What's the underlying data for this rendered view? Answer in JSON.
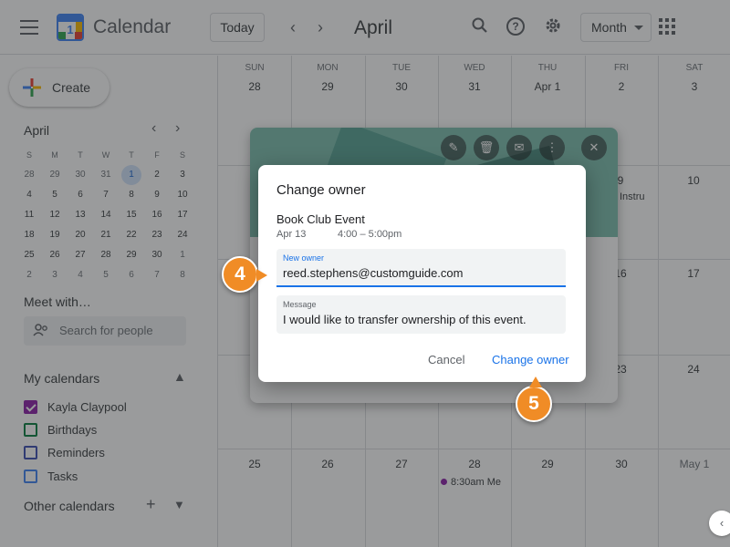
{
  "header": {
    "app_title": "Calendar",
    "logo_day": "1",
    "today_label": "Today",
    "prev_glyph": "‹",
    "next_glyph": "›",
    "month": "April",
    "view_select": "Month",
    "icons": [
      "menu-icon",
      "search-icon",
      "help-icon",
      "gear-icon",
      "apps-icon"
    ]
  },
  "sidebar": {
    "create_label": "Create",
    "mini_calendar": {
      "month": "April",
      "days_of_week": [
        "S",
        "M",
        "T",
        "W",
        "T",
        "F",
        "S"
      ],
      "weeks": [
        [
          "28",
          "29",
          "30",
          "31",
          "1",
          "2",
          "3"
        ],
        [
          "4",
          "5",
          "6",
          "7",
          "8",
          "9",
          "10"
        ],
        [
          "11",
          "12",
          "13",
          "14",
          "15",
          "16",
          "17"
        ],
        [
          "18",
          "19",
          "20",
          "21",
          "22",
          "23",
          "24"
        ],
        [
          "25",
          "26",
          "27",
          "28",
          "29",
          "30",
          "1"
        ],
        [
          "2",
          "3",
          "4",
          "5",
          "6",
          "7",
          "8"
        ]
      ]
    },
    "meet_title": "Meet with…",
    "people_search_placeholder": "Search for people",
    "my_calendars_title": "My calendars",
    "my_calendars": [
      {
        "label": "Kayla Claypool",
        "color": "#8e24aa",
        "checked": true
      },
      {
        "label": "Birthdays",
        "color": "#0b8043",
        "checked": false
      },
      {
        "label": "Reminders",
        "color": "#3f51b5",
        "checked": false
      },
      {
        "label": "Tasks",
        "color": "#4285f4",
        "checked": false
      }
    ],
    "other_calendars_title": "Other calendars"
  },
  "grid": {
    "days_of_week": [
      "SUN",
      "MON",
      "TUE",
      "WED",
      "THU",
      "FRI",
      "SAT"
    ],
    "first_row_dates": [
      "28",
      "29",
      "30",
      "31",
      "Apr 1",
      "2",
      "3"
    ],
    "visible_dates": {
      "fri_row2": "9",
      "sat_row2": "10",
      "fri_row3": "16",
      "sat_row3": "17",
      "fri_row4": "23",
      "sat_row4": "24"
    },
    "last_row_dates": [
      "25",
      "26",
      "27",
      "28",
      "29",
      "30",
      "May 1"
    ],
    "event_fri_row2": "Instru",
    "event_wed_row5": "8:30am Me"
  },
  "dialog": {
    "title": "Change owner",
    "event_name": "Book Club Event",
    "event_date": "Apr 13",
    "event_time": "4:00 – 5:00pm",
    "new_owner_label": "New owner",
    "new_owner_value": "reed.stephens@customguide.com",
    "message_label": "Message",
    "message_value": "I would like to transfer ownership of this event.",
    "cancel_label": "Cancel",
    "confirm_label": "Change owner"
  },
  "steps": {
    "step_a": "4",
    "step_b": "5"
  },
  "colors": {
    "accent": "#1a73e8",
    "callout": "#f08c26"
  }
}
